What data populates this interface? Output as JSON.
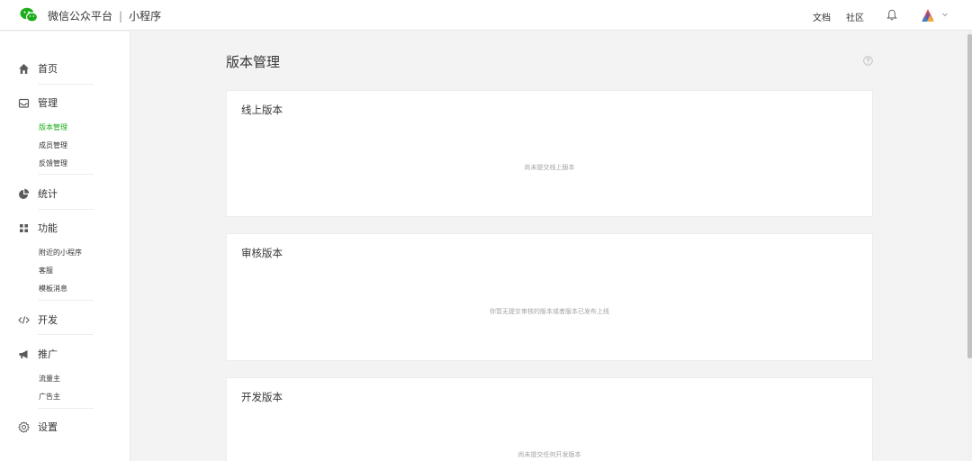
{
  "header": {
    "brand": "微信公众平台",
    "separator": "|",
    "product": "小程序",
    "links": {
      "docs": "文档",
      "community": "社区"
    }
  },
  "sidebar": {
    "home": "首页",
    "manage": "管理",
    "manage_items": [
      "版本管理",
      "成员管理",
      "反馈管理"
    ],
    "stats": "统计",
    "features": "功能",
    "feature_items": [
      "附近的小程序",
      "客服",
      "模板消息"
    ],
    "develop": "开发",
    "promote": "推广",
    "promote_items": [
      "流量主",
      "广告主"
    ],
    "settings": "设置"
  },
  "main": {
    "title": "版本管理",
    "cards": [
      {
        "title": "线上版本",
        "empty": "尚未提交线上版本"
      },
      {
        "title": "审核版本",
        "empty": "你暂无提交审核的版本或者版本已发布上线"
      },
      {
        "title": "开发版本",
        "empty": "尚未提交任何开发版本"
      }
    ]
  },
  "colors": {
    "accent": "#1aad19",
    "text": "#353535",
    "muted": "#a3a3a3",
    "background": "#f3f3f3"
  },
  "icons": {
    "logo": "wechat-miniprogram-logo",
    "bell": "bell-icon",
    "help": "help-icon"
  }
}
